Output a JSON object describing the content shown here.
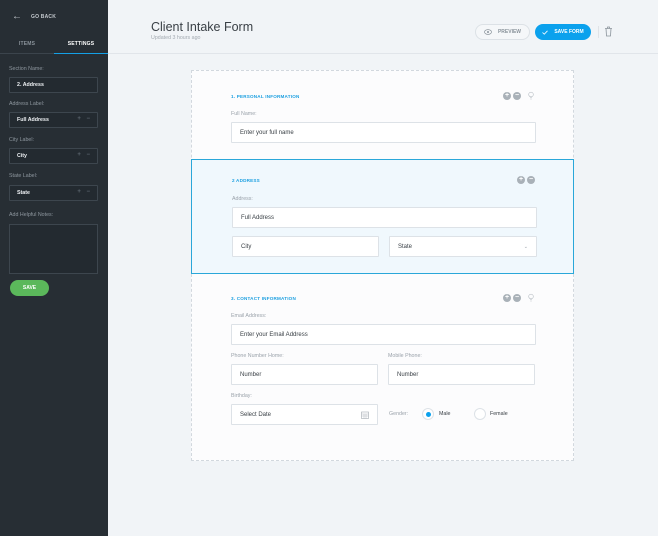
{
  "sidebar": {
    "go_back": "GO BACK",
    "tabs": [
      {
        "label": "ITEMS",
        "active": false
      },
      {
        "label": "SETTINGS",
        "active": true
      }
    ],
    "section_name": {
      "label": "Section Name:",
      "value": "2. Address"
    },
    "address_label": {
      "label": "Address Label:",
      "value": "Full Address"
    },
    "city_label": {
      "label": "City Label:",
      "value": "City"
    },
    "state_label": {
      "label": "State Label:",
      "value": "State"
    },
    "notes": {
      "label": "Add Helpful Notes:",
      "value": ""
    },
    "save": "SAVE",
    "plus_minus": "+ −"
  },
  "header": {
    "title": "Client Intake Form",
    "subtitle": "Updated 3 hours ago",
    "preview": "PREVIEW",
    "save_form": "SAVE FORM"
  },
  "form": {
    "sections": [
      {
        "title": "1. PERSONAL INFORMATION",
        "full_name": {
          "label": "Full Name:",
          "placeholder": "Enter your full name"
        }
      },
      {
        "title": "2 ADDRESS",
        "address": {
          "label": "Address:",
          "placeholder": "Full Address"
        },
        "city": {
          "placeholder": "City"
        },
        "state": {
          "value": "State"
        }
      },
      {
        "title": "3. CONTACT INFORMATION",
        "email": {
          "label": "Email Address:",
          "placeholder": "Enter your Email Address"
        },
        "phone_home": {
          "label": "Phone Number Home:",
          "placeholder": "Number"
        },
        "mobile": {
          "label": "Mobile Phone:",
          "placeholder": "Number"
        },
        "birthday": {
          "label": "Birthday:",
          "placeholder": "Select Date"
        },
        "gender": {
          "label": "Gender:",
          "options": [
            "Male",
            "Female"
          ],
          "selected": "Male"
        }
      }
    ]
  },
  "colors": {
    "accent": "#0ba1ed",
    "sidebar_bg": "#272e34",
    "save_green": "#5bb85b"
  }
}
